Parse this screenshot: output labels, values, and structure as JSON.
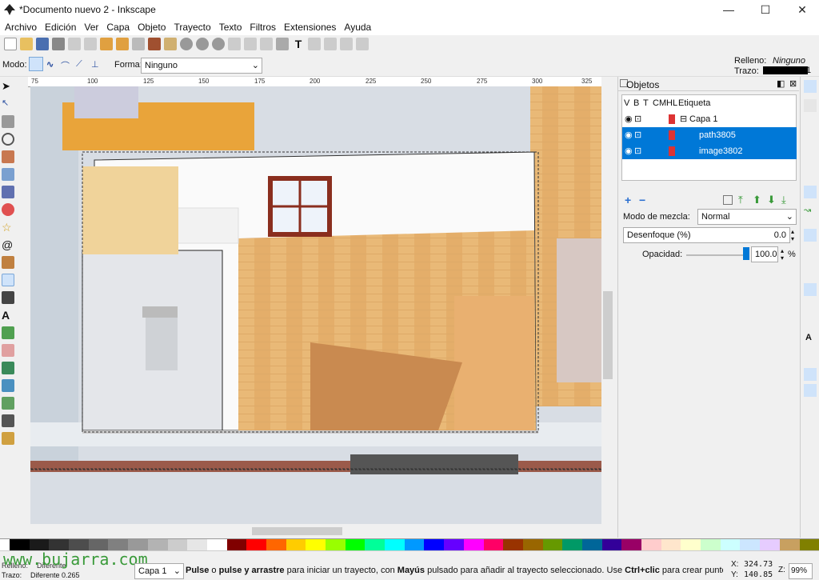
{
  "window": {
    "title": "*Documento nuevo 2 - Inkscape",
    "minimize": "—",
    "maximize": "☐",
    "close": "✕"
  },
  "menu": [
    "Archivo",
    "Edición",
    "Ver",
    "Capa",
    "Objeto",
    "Trayecto",
    "Texto",
    "Filtros",
    "Extensiones",
    "Ayuda"
  ],
  "modebar": {
    "mode_label": "Modo:",
    "shape_label": "Forma:",
    "shape_value": "Ninguno",
    "fill_label": "Relleno:",
    "fill_value": "Ninguno",
    "stroke_label": "Trazo:",
    "stroke_value": "1"
  },
  "ruler": {
    "ticks": [
      "75",
      "100",
      "125",
      "150",
      "175",
      "200",
      "225",
      "250",
      "275",
      "300",
      "325"
    ]
  },
  "objects_panel": {
    "title": "Objetos",
    "headers": {
      "v": "V",
      "b": "B",
      "t": "T",
      "cm": "CM",
      "hl": "HL",
      "label": "Etiqueta"
    },
    "rows": [
      {
        "label": "Capa 1",
        "selected": false
      },
      {
        "label": "path3805",
        "selected": true
      },
      {
        "label": "image3802",
        "selected": true
      }
    ],
    "blend_label": "Modo de mezcla:",
    "blend_value": "Normal",
    "blur_label": "Desenfoque (%)",
    "blur_value": "0.0",
    "opacity_label": "Opacidad:",
    "opacity_value": "100.0",
    "opacity_unit": "%"
  },
  "status": {
    "fill_label": "Relleno:",
    "fill_value": "Diferente",
    "stroke_label": "Trazo:",
    "stroke_value": "Diferente 0.265",
    "layer": "Capa 1",
    "message_pre": "Pulse",
    "message_or": " o ",
    "message_bold2": "pulse y arrastre",
    "message_mid": " para iniciar un trayecto, con ",
    "message_bold3": "Mayús",
    "message_mid2": " pulsado para añadir al trayecto seleccionado. Use ",
    "message_bold4": "Ctrl+clic",
    "message_end": " para crear punto...",
    "x_label": "X:",
    "x_value": "324.73",
    "y_label": "Y:",
    "y_value": "140.85",
    "z_label": "Z:",
    "zoom": "99%"
  },
  "watermark": "www.bujarra.com",
  "colors": {
    "selection": "#0078d7",
    "accent_green": "#3a9a3a"
  }
}
